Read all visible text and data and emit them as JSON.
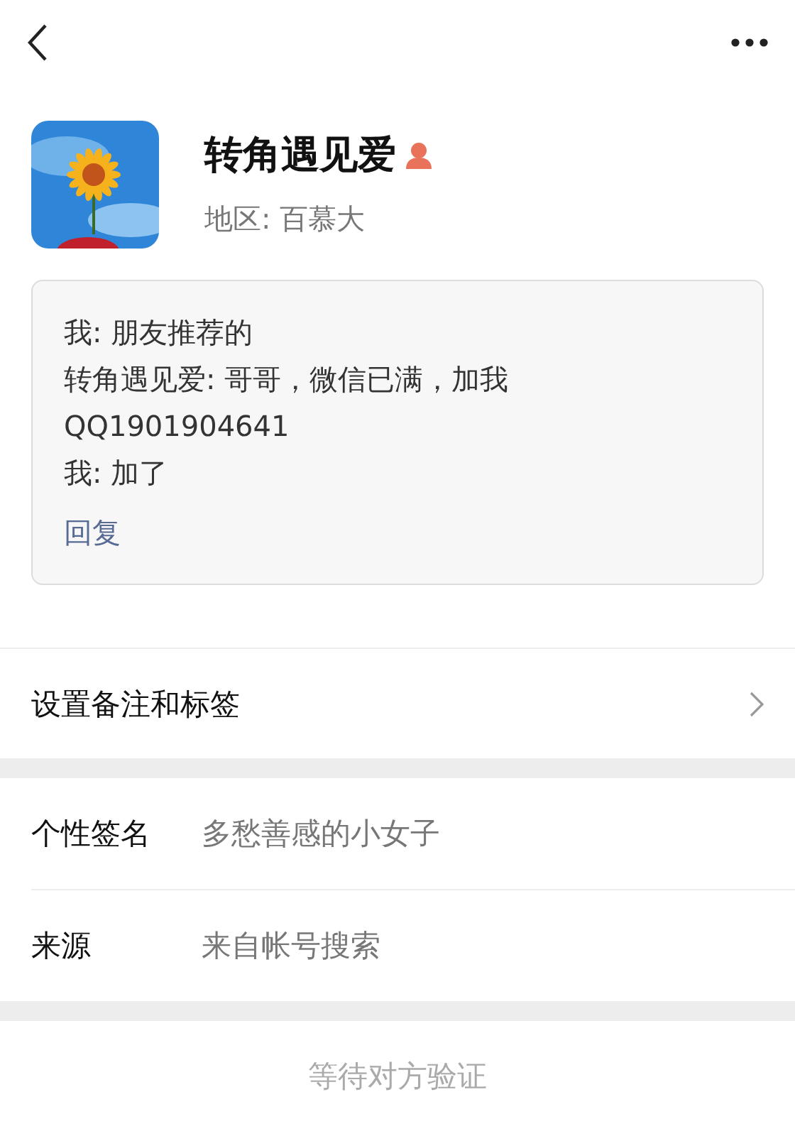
{
  "profile": {
    "name": "转角遇见爱",
    "gender_icon": true,
    "region": "地区: 百慕大"
  },
  "message_lines": [
    "我: 朋友推荐的",
    "转角遇见爱: 哥哥，微信已满，加我QQ1901904641",
    "我: 加了"
  ],
  "reply_link": "回复",
  "remark_row": {
    "label": "设置备注和标签"
  },
  "info_rows": [
    {
      "label": "个性签名",
      "value": "多愁善感的小女子"
    },
    {
      "label": "来源",
      "value": "来自帐号搜索"
    }
  ],
  "status_button": {
    "label": "等待对方验证",
    "disabled": true
  }
}
